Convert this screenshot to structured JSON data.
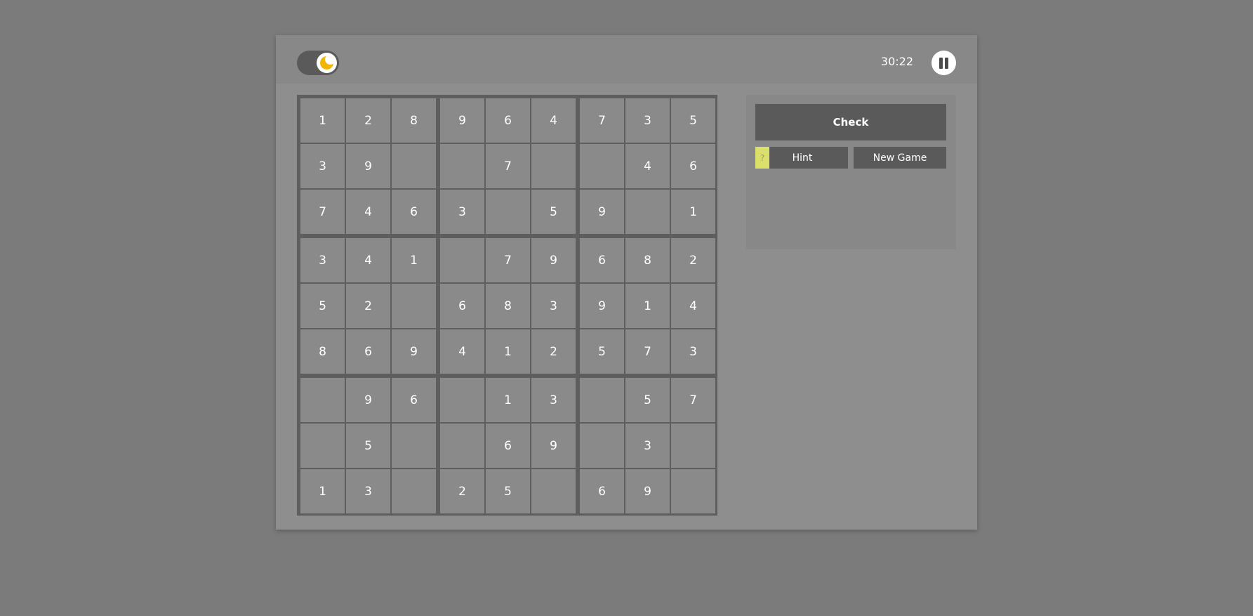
{
  "header": {
    "timer": "30:22",
    "theme_toggle": {
      "state": "dark",
      "icon": "moon-icon"
    },
    "pause_icon": "pause-icon"
  },
  "board": {
    "rows": [
      [
        "1",
        "2",
        "8",
        "9",
        "6",
        "4",
        "7",
        "3",
        "5"
      ],
      [
        "3",
        "9",
        "",
        "",
        "7",
        "",
        "",
        "4",
        "6"
      ],
      [
        "7",
        "4",
        "6",
        "3",
        "",
        "5",
        "9",
        "",
        "1"
      ],
      [
        "3",
        "4",
        "1",
        "",
        "7",
        "9",
        "6",
        "8",
        "2"
      ],
      [
        "5",
        "2",
        "",
        "6",
        "8",
        "3",
        "9",
        "1",
        "4"
      ],
      [
        "8",
        "6",
        "9",
        "4",
        "1",
        "2",
        "5",
        "7",
        "3"
      ],
      [
        "",
        "9",
        "6",
        "",
        "1",
        "3",
        "",
        "5",
        "7"
      ],
      [
        "",
        "5",
        "",
        "",
        "6",
        "9",
        "",
        "3",
        ""
      ],
      [
        "1",
        "3",
        "",
        "2",
        "5",
        "",
        "6",
        "9",
        ""
      ]
    ]
  },
  "side": {
    "check_label": "Check",
    "hint_badge": "?",
    "hint_label": "Hint",
    "new_game_label": "New Game"
  },
  "colors": {
    "background": "#7b7b7b",
    "panel": "#8e8e8e",
    "button": "#5a5a5a",
    "hint_badge": "#dbe06a",
    "moon": "#f2b705"
  }
}
